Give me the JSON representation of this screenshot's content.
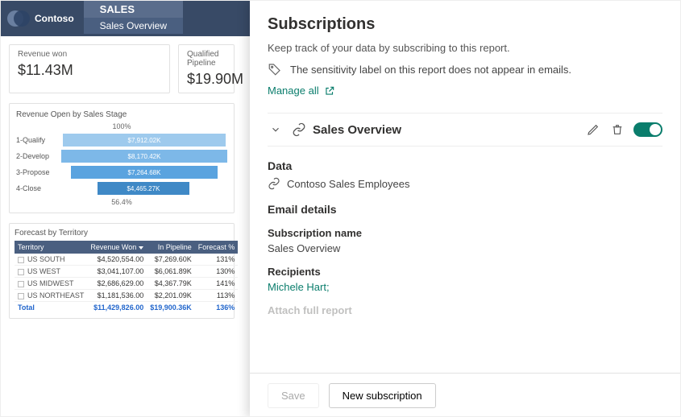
{
  "brand": "Contoso",
  "nav": {
    "group": "SALES",
    "page": "Sales Overview"
  },
  "cards": {
    "revenue_won": {
      "label": "Revenue won",
      "value": "$11.43M"
    },
    "qualified_pipeline": {
      "label": "Qualified Pipeline",
      "value": "$19.90M"
    }
  },
  "stage_chart": {
    "title": "Revenue Open by Sales Stage",
    "top_pct": "100%",
    "bottom_pct": "56.4%",
    "stages": [
      {
        "label": "1-Qualify",
        "value": "$7,912.02K",
        "offset_pct": 1,
        "width_pct": 98,
        "colorClass": "c-b1"
      },
      {
        "label": "2-Develop",
        "value": "$8,170.42K",
        "offset_pct": 0,
        "width_pct": 100,
        "colorClass": "c-b2"
      },
      {
        "label": "3-Propose",
        "value": "$7,264.68K",
        "offset_pct": 6,
        "width_pct": 88,
        "colorClass": "c-b3"
      },
      {
        "label": "4-Close",
        "value": "$4,465.27K",
        "offset_pct": 22,
        "width_pct": 55,
        "colorClass": "c-b4"
      }
    ]
  },
  "territory_table": {
    "title": "Forecast by Territory",
    "headers": [
      "Territory",
      "Revenue Won",
      "In Pipeline",
      "Forecast %"
    ],
    "rows": [
      {
        "territory": "US SOUTH",
        "won": "$4,520,554.00",
        "pipe": "$7,269.60K",
        "fc": "131%"
      },
      {
        "territory": "US WEST",
        "won": "$3,041,107.00",
        "pipe": "$6,061.89K",
        "fc": "130%"
      },
      {
        "territory": "US MIDWEST",
        "won": "$2,686,629.00",
        "pipe": "$4,367.79K",
        "fc": "141%"
      },
      {
        "territory": "US NORTHEAST",
        "won": "$1,181,536.00",
        "pipe": "$2,201.09K",
        "fc": "113%"
      }
    ],
    "total": {
      "territory": "Total",
      "won": "$11,429,826.00",
      "pipe": "$19,900.36K",
      "fc": "136%"
    }
  },
  "pane": {
    "title": "Subscriptions",
    "subtitle": "Keep track of your data by subscribing to this report.",
    "sensitivity": "The sensitivity label on this report does not appear in emails.",
    "manage_all": "Manage all",
    "sub": {
      "name": "Sales Overview",
      "data_heading": "Data",
      "data_value": "Contoso Sales Employees",
      "email_heading": "Email details",
      "name_label": "Subscription name",
      "name_value": "Sales Overview",
      "recipients_label": "Recipients",
      "recipients_value": "Michele Hart;",
      "attach_label": "Attach full report"
    },
    "footer": {
      "save": "Save",
      "new": "New subscription"
    }
  },
  "chart_data": {
    "type": "bar",
    "title": "Revenue Open by Sales Stage",
    "categories": [
      "1-Qualify",
      "2-Develop",
      "3-Propose",
      "4-Close"
    ],
    "values_k": [
      7912.02,
      8170.42,
      7264.68,
      4465.27
    ],
    "funnel_top_pct": 100,
    "funnel_bottom_pct": 56.4,
    "xlabel": "",
    "ylabel": ""
  }
}
